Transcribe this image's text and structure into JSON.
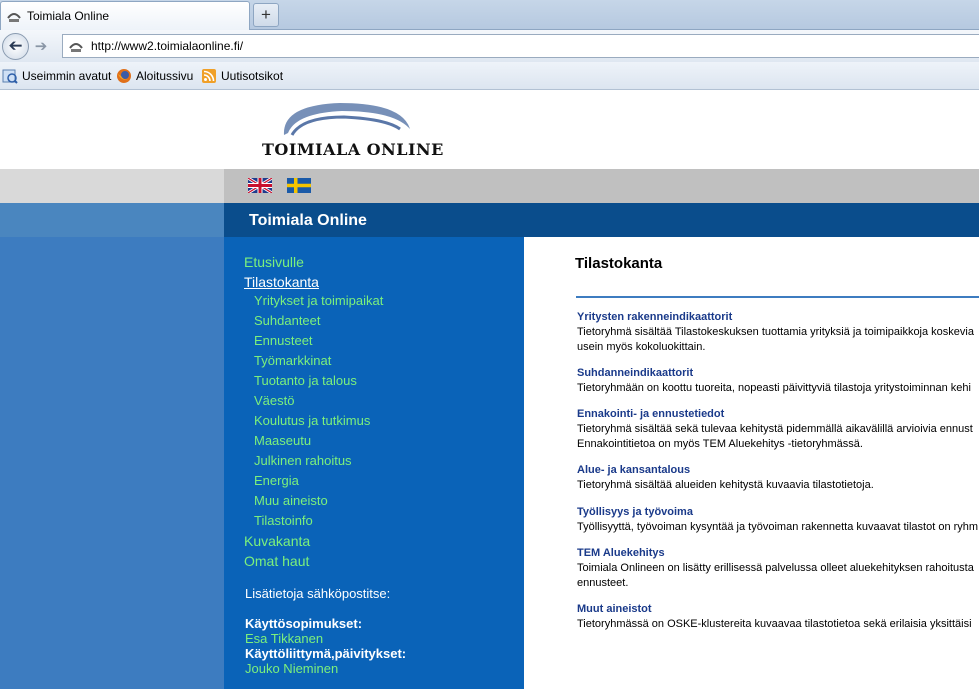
{
  "browser": {
    "tab_title": "Toimiala Online",
    "new_tab_label": "+",
    "url": "http://www2.toimialaonline.fi/",
    "bookmarks": [
      {
        "label": "Useimmin avatut",
        "icon": "most-visited-icon"
      },
      {
        "label": "Aloitussivu",
        "icon": "firefox-icon"
      },
      {
        "label": "Uutisotsikot",
        "icon": "rss-feed-icon"
      }
    ]
  },
  "header": {
    "logo_text": "TOIMIALA ONLINE",
    "languages": [
      {
        "name": "english-flag"
      },
      {
        "name": "swedish-flag"
      }
    ],
    "site_title": "Toimiala Online"
  },
  "nav": {
    "etusivulle": "Etusivulle",
    "tilastokanta": "Tilastokanta",
    "subitems": [
      "Yritykset ja toimipaikat",
      "Suhdanteet",
      "Ennusteet",
      "Työmarkkinat",
      "Tuotanto ja talous",
      "Väestö",
      "Koulutus ja tutkimus",
      "Maaseutu",
      "Julkinen rahoitus",
      "Energia",
      "Muu aineisto",
      "Tilastoinfo"
    ],
    "kuvakanta": "Kuvakanta",
    "omat_haut": "Omat haut",
    "info_label": "Lisätietoja sähköpostitse:",
    "contacts": [
      {
        "role": "Käyttösopimukset:",
        "name": "Esa Tikkanen"
      },
      {
        "role": "Käyttöliittymä,päivitykset:",
        "name": "Jouko Nieminen"
      }
    ]
  },
  "content": {
    "heading": "Tilastokanta",
    "items": [
      {
        "title": "Yritysten rakenneindikaattorit",
        "lines": [
          "Tietoryhmä sisältää Tilastokeskuksen tuottamia yrityksiä ja toimipaikkoja koskevia",
          "usein myös kokoluokittain."
        ]
      },
      {
        "title": "Suhdanneindikaattorit",
        "lines": [
          "Tietoryhmään on koottu tuoreita, nopeasti päivittyviä tilastoja yritystoiminnan kehi"
        ]
      },
      {
        "title": "Ennakointi- ja ennustetiedot",
        "lines": [
          "Tietoryhmä sisältää sekä tulevaa kehitystä pidemmällä aikavälillä arvioivia ennust",
          "Ennakointitietoa on myös TEM Aluekehitys -tietoryhmässä."
        ]
      },
      {
        "title": "Alue- ja kansantalous",
        "lines": [
          "Tietoryhmä sisältää alueiden kehitystä kuvaavia tilastotietoja."
        ]
      },
      {
        "title": "Työllisyys ja työvoima",
        "lines": [
          "Työllisyyttä, työvoiman kysyntää ja työvoiman rakennetta kuvaavat tilastot on ryhm"
        ]
      },
      {
        "title": "TEM Aluekehitys",
        "lines": [
          "Toimiala Onlineen on lisätty erillisessä palvelussa olleet aluekehityksen rahoitusta",
          "ennusteet."
        ]
      },
      {
        "title": "Muut aineistot",
        "lines": [
          "Tietoryhmässä on OSKE-klustereita kuvaavaa tilastotietoa sekä erilaisia yksittäisi"
        ]
      }
    ]
  },
  "colors": {
    "nav_bg": "#0a63b8",
    "title_bar": "#0a4d8c",
    "nav_link": "#7cf07c",
    "item_title": "#1a3a8a"
  }
}
